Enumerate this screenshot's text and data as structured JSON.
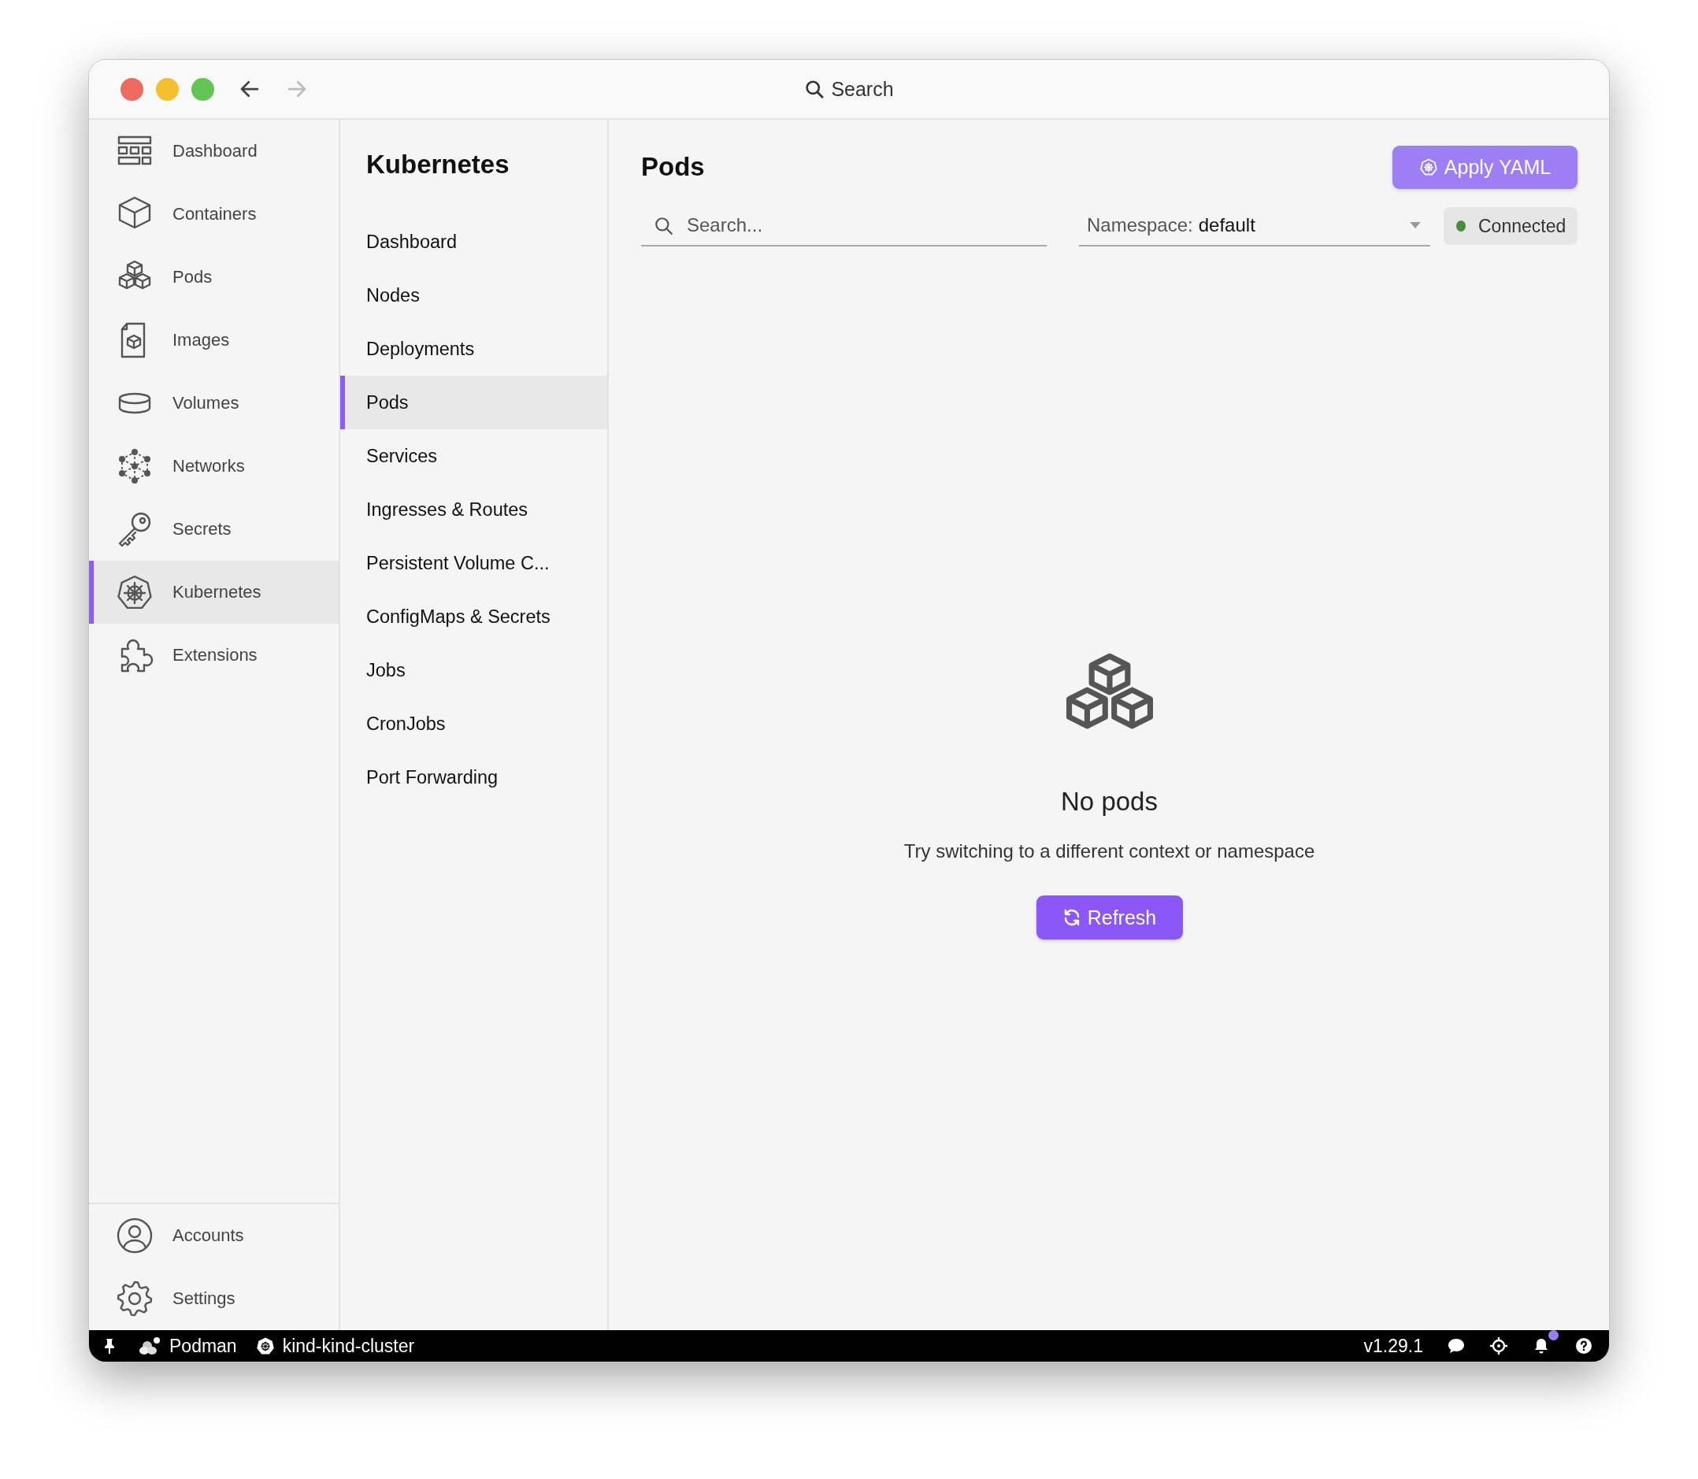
{
  "window": {
    "search_label": "Search",
    "back_disabled": false,
    "forward_disabled": true
  },
  "nav": {
    "items": [
      {
        "label": "Dashboard",
        "selected": false
      },
      {
        "label": "Containers",
        "selected": false
      },
      {
        "label": "Pods",
        "selected": false
      },
      {
        "label": "Images",
        "selected": false
      },
      {
        "label": "Volumes",
        "selected": false
      },
      {
        "label": "Networks",
        "selected": false
      },
      {
        "label": "Secrets",
        "selected": false
      },
      {
        "label": "Kubernetes",
        "selected": true
      },
      {
        "label": "Extensions",
        "selected": false
      }
    ],
    "bottom_items": [
      {
        "label": "Accounts",
        "selected": false
      },
      {
        "label": "Settings",
        "selected": false
      }
    ]
  },
  "kubernetes_menu": {
    "title": "Kubernetes",
    "items": [
      {
        "label": "Dashboard",
        "selected": false
      },
      {
        "label": "Nodes",
        "selected": false
      },
      {
        "label": "Deployments",
        "selected": false
      },
      {
        "label": "Pods",
        "selected": true
      },
      {
        "label": "Services",
        "selected": false
      },
      {
        "label": "Ingresses & Routes",
        "selected": false
      },
      {
        "label": "Persistent Volume C...",
        "selected": false
      },
      {
        "label": "ConfigMaps & Secrets",
        "selected": false
      },
      {
        "label": "Jobs",
        "selected": false
      },
      {
        "label": "CronJobs",
        "selected": false
      },
      {
        "label": "Port Forwarding",
        "selected": false
      }
    ]
  },
  "page": {
    "title": "Pods",
    "apply_button": {
      "label": "Apply YAML"
    },
    "search": {
      "placeholder": "Search..."
    },
    "namespace": {
      "label": "Namespace:",
      "value": "default"
    },
    "connection": {
      "label": "Connected",
      "connected": true
    },
    "empty_state": {
      "title": "No pods",
      "message": "Try switching to a different context or namespace",
      "button": "Refresh"
    }
  },
  "status_bar": {
    "engine": "Podman",
    "context": "kind-kind-cluster",
    "version": "v1.29.1",
    "has_notifications": true
  }
}
